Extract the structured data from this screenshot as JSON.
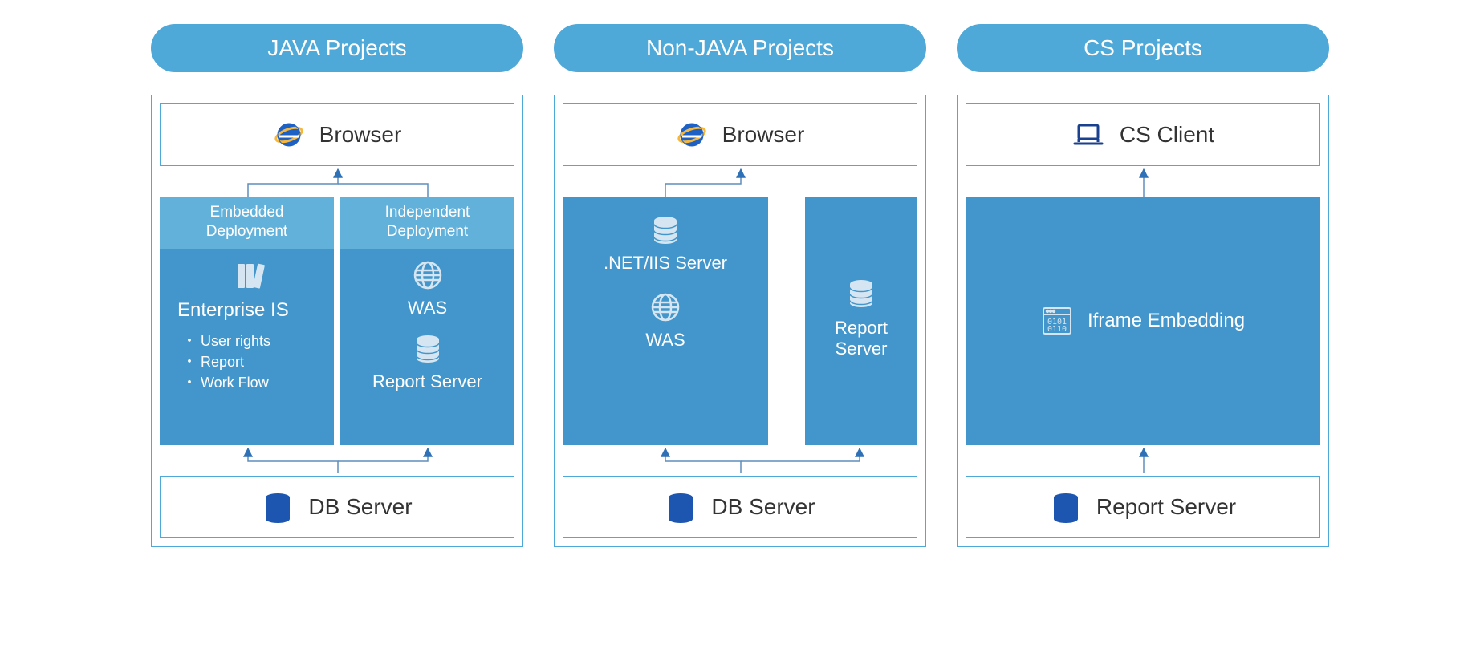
{
  "columns": [
    {
      "title": "JAVA Projects",
      "top_box": {
        "icon": "ie-icon",
        "label": "Browser"
      },
      "deployments": [
        {
          "header": "Embedded\nDeployment",
          "icon": "books-icon",
          "title": "Enterprise IS",
          "bullets": [
            "User rights",
            "Report",
            "Work Flow"
          ]
        },
        {
          "header": "Independent\nDeployment",
          "blocks": [
            {
              "icon": "globe-icon",
              "label": "WAS"
            },
            {
              "icon": "db-icon",
              "label": "Report Server"
            }
          ]
        }
      ],
      "bottom_box": {
        "icon": "db-icon",
        "label": "DB Server"
      }
    },
    {
      "title": "Non-JAVA Projects",
      "top_box": {
        "icon": "ie-icon",
        "label": "Browser"
      },
      "mid_panels": [
        {
          "blocks": [
            {
              "icon": "db-icon",
              "label": ".NET/IIS Server"
            },
            {
              "icon": "globe-icon",
              "label": "WAS"
            }
          ]
        },
        {
          "blocks": [
            {
              "icon": "db-icon",
              "label": "Report Server"
            }
          ]
        }
      ],
      "bottom_box": {
        "icon": "db-icon",
        "label": "DB Server"
      }
    },
    {
      "title": "CS Projects",
      "top_box": {
        "icon": "laptop-icon",
        "label": "CS Client"
      },
      "single_panel": {
        "icon": "binary-window-icon",
        "label": "Iframe Embedding"
      },
      "bottom_box": {
        "icon": "db-icon",
        "label": "Report Server"
      }
    }
  ]
}
